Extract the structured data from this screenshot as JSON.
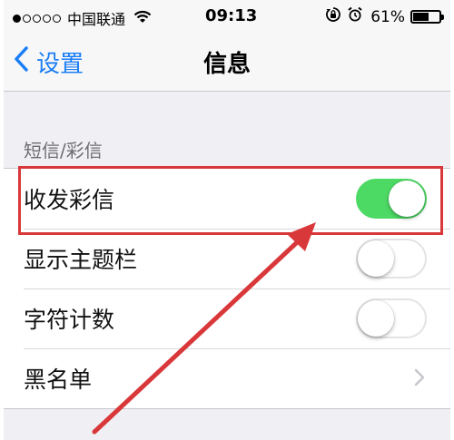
{
  "status_bar": {
    "carrier": "中国联通",
    "time": "09:13",
    "battery_percent_text": "61%",
    "battery_level": 0.61,
    "signal_dots_filled": 1,
    "signal_dots_total": 5,
    "icons": [
      "wifi-icon",
      "rotation-lock-icon",
      "alarm-icon",
      "battery-icon"
    ]
  },
  "nav": {
    "back_label": "设置",
    "title": "信息"
  },
  "section": {
    "header": "短信/彩信",
    "rows": [
      {
        "label": "收发彩信",
        "control": "switch",
        "on": true
      },
      {
        "label": "显示主题栏",
        "control": "switch",
        "on": false
      },
      {
        "label": "字符计数",
        "control": "switch",
        "on": false
      },
      {
        "label": "黑名单",
        "control": "disclosure"
      }
    ]
  },
  "colors": {
    "accent": "#1a7ef5",
    "switch_on": "#4cd964",
    "annotation": "#d9383b"
  }
}
